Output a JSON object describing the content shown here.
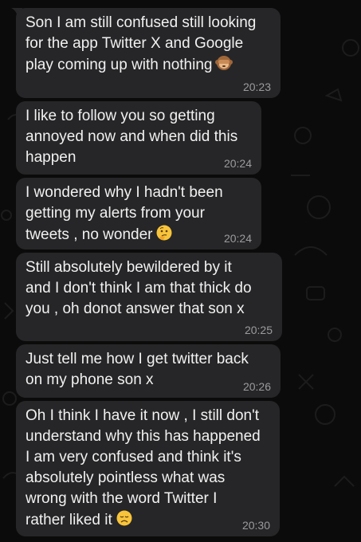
{
  "messages": [
    {
      "text": "Son I am still confused still looking\nfor the app Twitter X and Google\nplay coming up with nothing",
      "emoji": "see-no-evil-monkey-icon",
      "time": "20:23"
    },
    {
      "text": "I like to follow you so getting\nannoyed now and when did this\nhappen",
      "emoji": "",
      "time": "20:24"
    },
    {
      "text": "I wondered why I hadn't been\ngetting my alerts from your\ntweets , no wonder",
      "emoji": "thinking-face-icon",
      "time": "20:24"
    },
    {
      "text": "Still absolutely bewildered by it\nand I don't think I am that thick do\nyou , oh donot answer that son x",
      "emoji": "",
      "time": "20:25"
    },
    {
      "text": "Just tell me how I get twitter back\non my phone son x",
      "emoji": "",
      "time": "20:26"
    },
    {
      "text": "Oh I think I have it now , I still don't\nunderstand why this has happened\nI am very confused and think it's\nabsolutely pointless what was\nwrong with the word Twitter I\nrather liked it",
      "emoji": "disappointed-face-icon",
      "time": "20:30"
    }
  ],
  "colors": {
    "background": "#0b0b0b",
    "bubble": "#262628",
    "text": "#f1f1f1",
    "timestamp": "#9b9b9e"
  }
}
